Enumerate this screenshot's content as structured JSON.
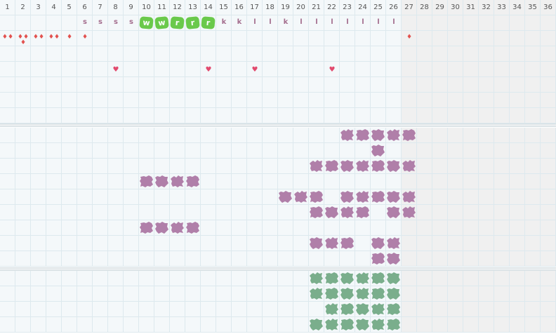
{
  "columns": [
    "1",
    "2",
    "3",
    "4",
    "5",
    "6",
    "7",
    "8",
    "9",
    "10",
    "11",
    "12",
    "13",
    "14",
    "15",
    "16",
    "17",
    "18",
    "19",
    "20",
    "21",
    "22",
    "23",
    "24",
    "25",
    "26",
    "27",
    "28",
    "29",
    "30",
    "31",
    "32",
    "33",
    "34",
    "35",
    "36"
  ],
  "highlight_until_col": 26,
  "colors": {
    "grid_bg": "#f4f8fa",
    "grid_bg_inactive": "#f0f0f0",
    "grid_line": "#dde9ee",
    "letter": "#a46e8e",
    "badge": "#6ac94b",
    "drop": "#e2524f",
    "heart": "#e24a6e",
    "purple_blob": "#b07fa9",
    "green_blob": "#7aae8c"
  },
  "row2_letters": [
    {
      "col": 6,
      "text": "s"
    },
    {
      "col": 7,
      "text": "s"
    },
    {
      "col": 8,
      "text": "s"
    },
    {
      "col": 9,
      "text": "s"
    },
    {
      "col": 15,
      "text": "k"
    },
    {
      "col": 16,
      "text": "k"
    },
    {
      "col": 17,
      "text": "l"
    },
    {
      "col": 18,
      "text": "l"
    },
    {
      "col": 19,
      "text": "k"
    },
    {
      "col": 20,
      "text": "l"
    },
    {
      "col": 21,
      "text": "l"
    },
    {
      "col": 22,
      "text": "l"
    },
    {
      "col": 23,
      "text": "l"
    },
    {
      "col": 24,
      "text": "l"
    },
    {
      "col": 25,
      "text": "l"
    },
    {
      "col": 26,
      "text": "l"
    }
  ],
  "row2_badges": [
    {
      "col": 10,
      "text": "w"
    },
    {
      "col": 11,
      "text": "w"
    },
    {
      "col": 12,
      "text": "r"
    },
    {
      "col": 13,
      "text": "r"
    },
    {
      "col": 14,
      "text": "r"
    }
  ],
  "drops": [
    {
      "col": 1,
      "count": 2
    },
    {
      "col": 2,
      "count": 3
    },
    {
      "col": 3,
      "count": 2
    },
    {
      "col": 4,
      "count": 2
    },
    {
      "col": 5,
      "count": 1
    },
    {
      "col": 6,
      "count": 1
    },
    {
      "col": 27,
      "count": 1
    }
  ],
  "hearts": [
    8,
    14,
    17,
    22
  ],
  "purple_blobs": [
    {
      "row": 0,
      "cols": [
        23,
        24,
        25,
        26,
        27
      ]
    },
    {
      "row": 1,
      "cols": [
        25
      ]
    },
    {
      "row": 2,
      "cols": [
        21,
        22,
        23,
        24,
        25,
        26,
        27
      ]
    },
    {
      "row": 3,
      "cols": [
        10,
        11,
        12,
        13
      ]
    },
    {
      "row": 4,
      "cols": [
        19,
        20,
        21,
        23,
        24,
        25,
        26,
        27
      ]
    },
    {
      "row": 5,
      "cols": [
        21,
        22,
        23,
        24,
        26,
        27
      ]
    },
    {
      "row": 6,
      "cols": [
        10,
        11,
        12,
        13
      ]
    },
    {
      "row": 7,
      "cols": [
        21,
        22,
        23,
        25,
        26
      ]
    },
    {
      "row": 8,
      "cols": [
        25,
        26
      ]
    }
  ],
  "green_blobs": [
    {
      "row": 0,
      "cols": [
        21,
        22,
        23,
        24,
        25,
        26
      ]
    },
    {
      "row": 1,
      "cols": [
        21,
        22,
        23,
        24,
        25,
        26
      ]
    },
    {
      "row": 2,
      "cols": [
        22,
        23,
        24,
        25,
        26
      ]
    },
    {
      "row": 3,
      "cols": [
        21,
        22,
        23,
        24,
        25,
        26
      ]
    }
  ]
}
